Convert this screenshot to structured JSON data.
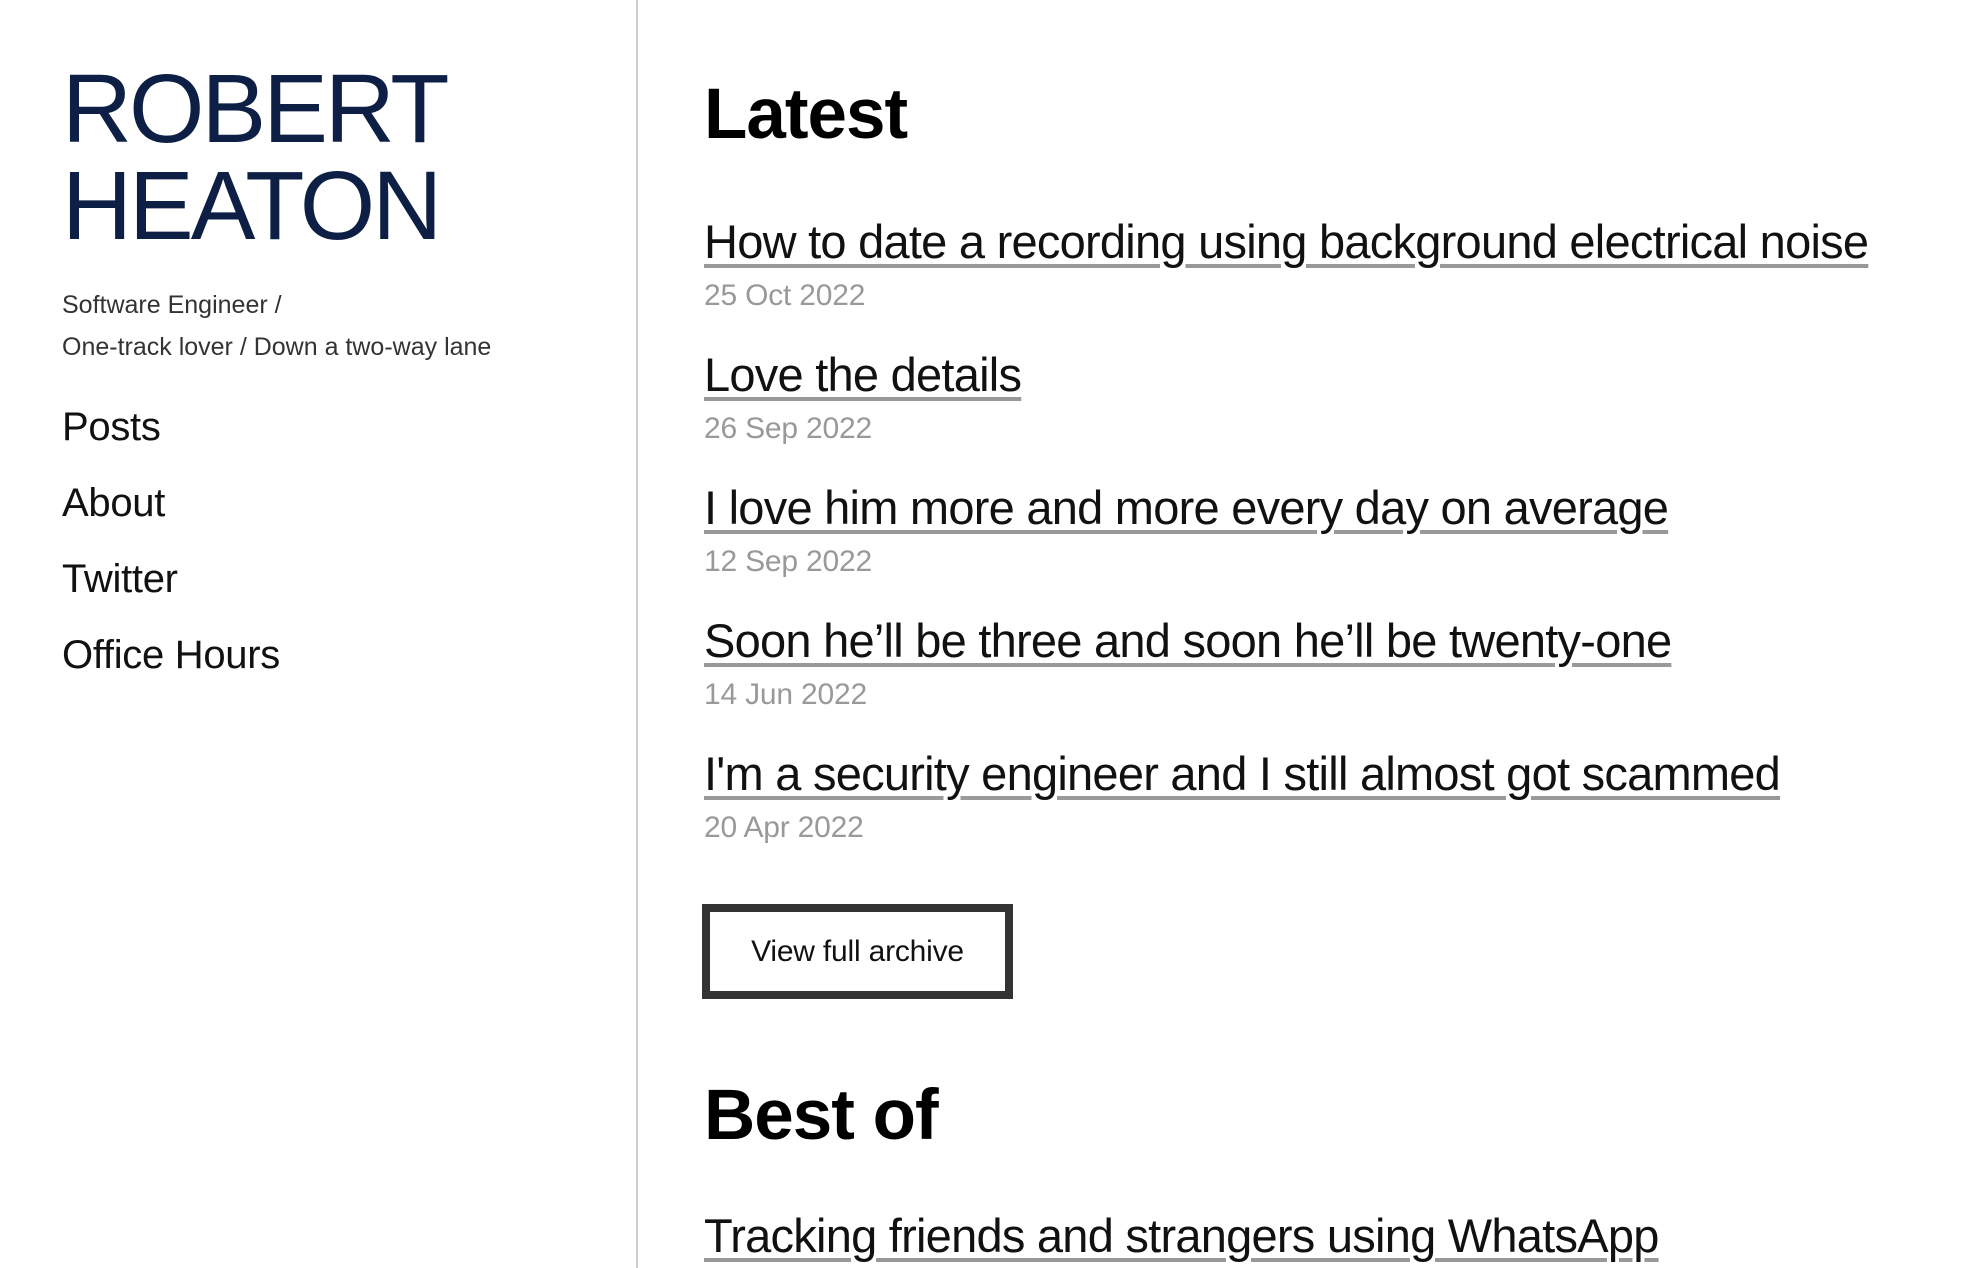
{
  "site": {
    "title_line1": "ROBERT",
    "title_line2": "HEATON",
    "tagline_line1": "Software Engineer /",
    "tagline_line2": "One-track lover / Down a two-way lane",
    "colors": {
      "title": "#0d1f45",
      "text": "#111111",
      "muted": "#999999",
      "divider": "#cccccc",
      "button_border": "#333333"
    }
  },
  "nav": {
    "items": [
      {
        "label": "Posts"
      },
      {
        "label": "About"
      },
      {
        "label": "Twitter"
      },
      {
        "label": "Office Hours"
      }
    ]
  },
  "latest": {
    "heading": "Latest",
    "posts": [
      {
        "title": "How to date a recording using background electrical noise",
        "date": "25 Oct 2022"
      },
      {
        "title": "Love the details",
        "date": "26 Sep 2022"
      },
      {
        "title": "I love him more and more every day on average",
        "date": "12 Sep 2022"
      },
      {
        "title": "Soon he’ll be three and soon he’ll be twenty-one",
        "date": "14 Jun 2022"
      },
      {
        "title": "I'm a security engineer and I still almost got scammed",
        "date": "20 Apr 2022"
      }
    ],
    "archive_button_label": "View full archive"
  },
  "best_of": {
    "heading": "Best of",
    "posts": [
      {
        "title": "Tracking friends and strangers using WhatsApp"
      }
    ]
  }
}
